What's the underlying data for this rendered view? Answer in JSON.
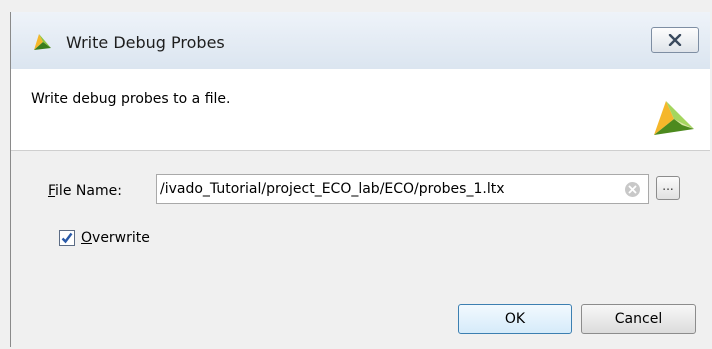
{
  "dialog": {
    "title": "Write Debug Probes",
    "title_icon": "vivado-logo-icon",
    "close_icon": "close-icon"
  },
  "header": {
    "description": "Write debug probes to a file.",
    "logo_icon": "vivado-logo-icon"
  },
  "form": {
    "file_name_label_mnemonic": "F",
    "file_name_label_rest": "ile Name:",
    "file_name_value": "/ivado_Tutorial/project_ECO_lab/ECO/probes_1.ltx",
    "browse_label": "...",
    "overwrite_checked": true,
    "overwrite_label_mnemonic": "O",
    "overwrite_label_rest": "verwrite"
  },
  "buttons": {
    "ok": "OK",
    "cancel": "Cancel"
  },
  "colors": {
    "logo_yellow": "#f5b72b",
    "logo_green": "#4c8a1e",
    "ok_border": "#3c7fb1"
  }
}
